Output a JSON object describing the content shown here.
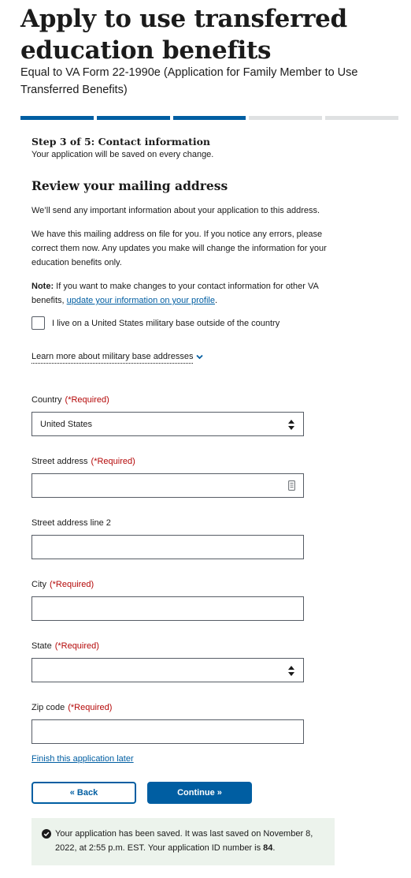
{
  "header": {
    "title": "Apply to use transferred education benefits",
    "subtitle": "Equal to VA Form 22-1990e (Application for Family Member to Use Transferred Benefits)"
  },
  "progress": {
    "total_steps": 5,
    "completed_steps": 3
  },
  "step": {
    "title": "Step 3 of 5: Contact information",
    "subtitle": "Your application will be saved on every change."
  },
  "section": {
    "title": "Review your mailing address",
    "p1": "We’ll send any important information about your application to this address.",
    "p2": "We have this mailing address on file for you. If you notice any errors, please correct them now. Any updates you make will change the information for your education benefits only.",
    "note_label": "Note:",
    "note_text": " If you want to make changes to your contact information for other VA benefits, ",
    "note_link": "update your information on your profile",
    "note_end": "."
  },
  "military_checkbox": {
    "label": "I live on a United States military base outside of the country",
    "checked": false
  },
  "learn_more": "Learn more about military base addresses",
  "required_text": "(*Required)",
  "fields": {
    "country": {
      "label": "Country",
      "value": "United States"
    },
    "street": {
      "label": "Street address",
      "value": ""
    },
    "street2": {
      "label": "Street address line 2",
      "value": ""
    },
    "city": {
      "label": "City",
      "value": ""
    },
    "state": {
      "label": "State",
      "value": ""
    },
    "zip": {
      "label": "Zip code",
      "value": ""
    }
  },
  "finish_later": "Finish this application later",
  "buttons": {
    "back": "« Back",
    "continue": "Continue »"
  },
  "alert": {
    "text": "Your application has been saved. It was last saved on November 8, 2022, at 2:55 p.m. EST. Your application ID number is ",
    "id": "84",
    "end": "."
  },
  "colors": {
    "primary": "#005ea2",
    "required": "#b50909",
    "success_bg": "#ecf3ec",
    "progress_incomplete": "#dfe1e2"
  }
}
